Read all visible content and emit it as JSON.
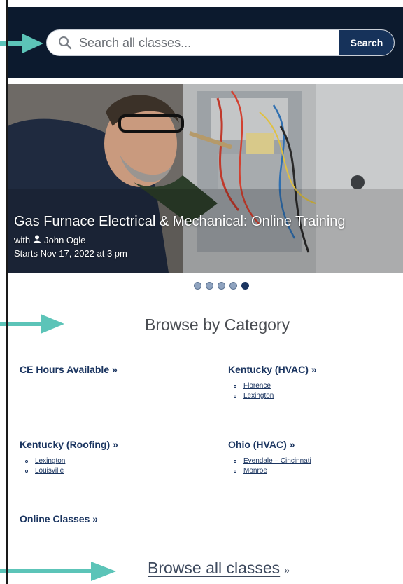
{
  "search": {
    "placeholder": "Search all classes...",
    "button_label": "Search"
  },
  "hero": {
    "title": "Gas Furnace Electrical & Mechanical: Online Training",
    "with_prefix": "with",
    "instructor": "John Ogle",
    "start": "Starts Nov 17, 2022 at 3 pm",
    "slide_count": 5,
    "active_slide": 5
  },
  "browse": {
    "title": "Browse by Category"
  },
  "categories": [
    {
      "title": "CE Hours Available »",
      "links": []
    },
    {
      "title": "Kentucky (HVAC) »",
      "links": [
        "Florence",
        "Lexington"
      ]
    },
    {
      "title": "Kentucky (Roofing) »",
      "links": [
        "Lexington",
        "Louisville"
      ]
    },
    {
      "title": "Ohio (HVAC) »",
      "links": [
        "Evendale – Cincinnati",
        "Monroe"
      ]
    },
    {
      "title": "Online Classes »",
      "links": []
    }
  ],
  "all_classes": {
    "label": "Browse all classes",
    "suffix": "»"
  },
  "colors": {
    "header_bg": "#0c1a2e",
    "accent_navy": "#16325a",
    "link": "#1b3560",
    "arrow": "#5cc4b8"
  }
}
